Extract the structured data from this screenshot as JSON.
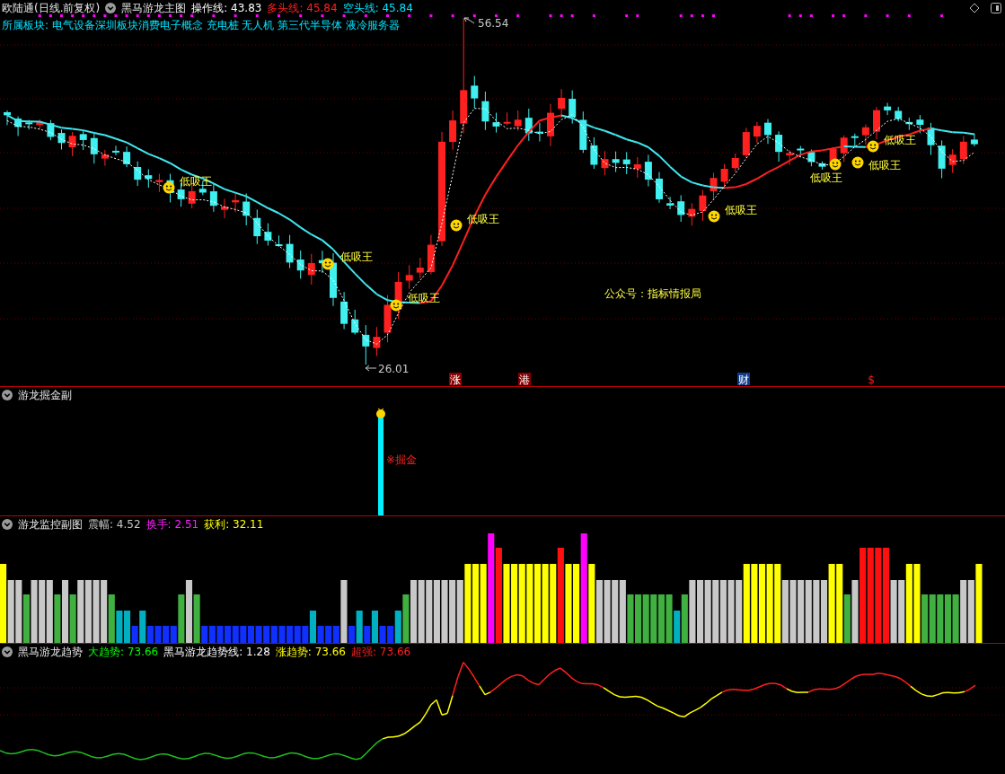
{
  "main": {
    "stock": "欧陆通(日线.前复权)",
    "indicator": "黑马游龙主图",
    "legend": [
      {
        "text": "操作线: 43.83",
        "color": "#ffffff"
      },
      {
        "text": "多头线: 45.84",
        "color": "#ff2020"
      },
      {
        "text": "空头线: 45.84",
        "color": "#00e5ff"
      }
    ],
    "sectors": "所属板块: 电气设备深圳板块消费电子概念 充电桩 无人机 第三代半导体 液冷服务器",
    "high_label": "56.54",
    "low_label": "26.01",
    "annotations": [
      {
        "text": "低吸王"
      },
      {
        "text": "低吸王"
      },
      {
        "text": "低吸王"
      },
      {
        "text": "低吸王"
      },
      {
        "text": "低吸王"
      },
      {
        "text": "低吸王"
      },
      {
        "text": "低吸王"
      },
      {
        "text": "低吸王"
      }
    ],
    "events": [
      {
        "text": "涨",
        "kind": "limit"
      },
      {
        "text": "港",
        "kind": "hk"
      },
      {
        "text": "财",
        "kind": "finance"
      },
      {
        "text": "$",
        "kind": "money"
      }
    ],
    "promo": "公众号：指标情报局"
  },
  "panes": [
    {
      "title": "游龙掘金副",
      "signal": "※掘金"
    },
    {
      "title": "游龙监控副图",
      "legend": [
        {
          "text": "震幅: 4.52",
          "color": "#c8c8c8"
        },
        {
          "text": "换手: 2.51",
          "color": "#ff20ff"
        },
        {
          "text": "获利: 32.11",
          "color": "#ffff00"
        }
      ]
    },
    {
      "title": "黑马游龙趋势",
      "legend": [
        {
          "text": "大趋势: 73.66",
          "color": "#00ff00"
        },
        {
          "text": "黑马游龙趋势线: 1.28",
          "color": "#ffffff"
        },
        {
          "text": "涨趋势: 73.66",
          "color": "#ffff00"
        },
        {
          "text": "超强: 73.66",
          "color": "#ff2020"
        }
      ]
    }
  ]
}
